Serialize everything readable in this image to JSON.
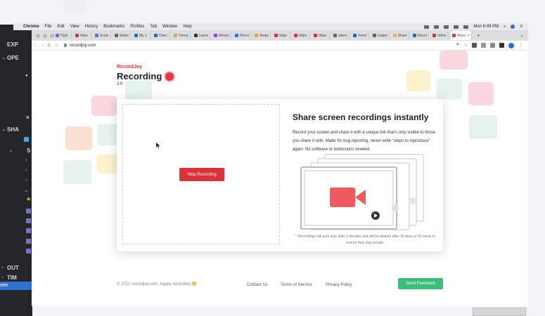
{
  "menubar": {
    "app": "Chrome",
    "items": [
      "File",
      "Edit",
      "View",
      "History",
      "Bookmarks",
      "Profiles",
      "Tab",
      "Window",
      "Help"
    ],
    "clock": "Mon 6:49 PM"
  },
  "left_panel": {
    "labels": [
      "EXP",
      "OPE",
      "SHA",
      "S",
      "OUT",
      "TIM",
      "ster"
    ]
  },
  "tabs": [
    {
      "label": "Hydr",
      "color": "#4a7cdc"
    },
    {
      "label": "https",
      "color": "#d6333b"
    },
    {
      "label": "Scalo",
      "color": "#4a7cdc"
    },
    {
      "label": "Solan",
      "color": "#666666"
    },
    {
      "label": "My J",
      "color": "#2b67b3"
    },
    {
      "label": "Direc",
      "color": "#2b67b3"
    },
    {
      "label": "Overp",
      "color": "#e8a33b"
    },
    {
      "label": "Launc",
      "color": "#333333"
    },
    {
      "label": "Messe",
      "color": "#8a4bd6"
    },
    {
      "label": "Recor",
      "color": "#3d6fd8"
    },
    {
      "label": "Analy",
      "color": "#e8a33b"
    },
    {
      "label": "https",
      "color": "#d6333b"
    },
    {
      "label": "https",
      "color": "#d6333b"
    },
    {
      "label": "https",
      "color": "#d6333b"
    },
    {
      "label": "taken",
      "color": "#666666"
    },
    {
      "label": "Feed",
      "color": "#2b67b3"
    },
    {
      "label": "kaspe",
      "color": "#666666"
    },
    {
      "label": "Share",
      "color": "#f0b44c"
    },
    {
      "label": "Recor",
      "color": "#2b67b3"
    },
    {
      "label": "Inbox",
      "color": "#d6333b"
    },
    {
      "label": "Reco",
      "color": "#e03a44"
    }
  ],
  "url": "recordjoy.com",
  "page": {
    "brand": "RecordJoy",
    "title": "Recording",
    "timer": "3:0",
    "stop_button": "Stop Recording",
    "heading": "Share screen recordings instantly",
    "description": "Record your screen and share it with a unique link that's only visible to those you share it with. Made for bug reporting, never write \"steps to reproduce\" again. No software or extensions needed.",
    "note": "* Recordings will auto stop after 3 minutes and will be deleted after 30 days or 50 views to ensure they stay private.",
    "copyright": "© 2021 recordjoy.com, happy recording 😁",
    "links": [
      "Contact Us",
      "Terms of Service",
      "Privacy Policy"
    ],
    "feedback_button": "Send Feedback"
  },
  "colors": {
    "accent_red": "#d6333b",
    "accent_green": "#3cbd7a"
  }
}
